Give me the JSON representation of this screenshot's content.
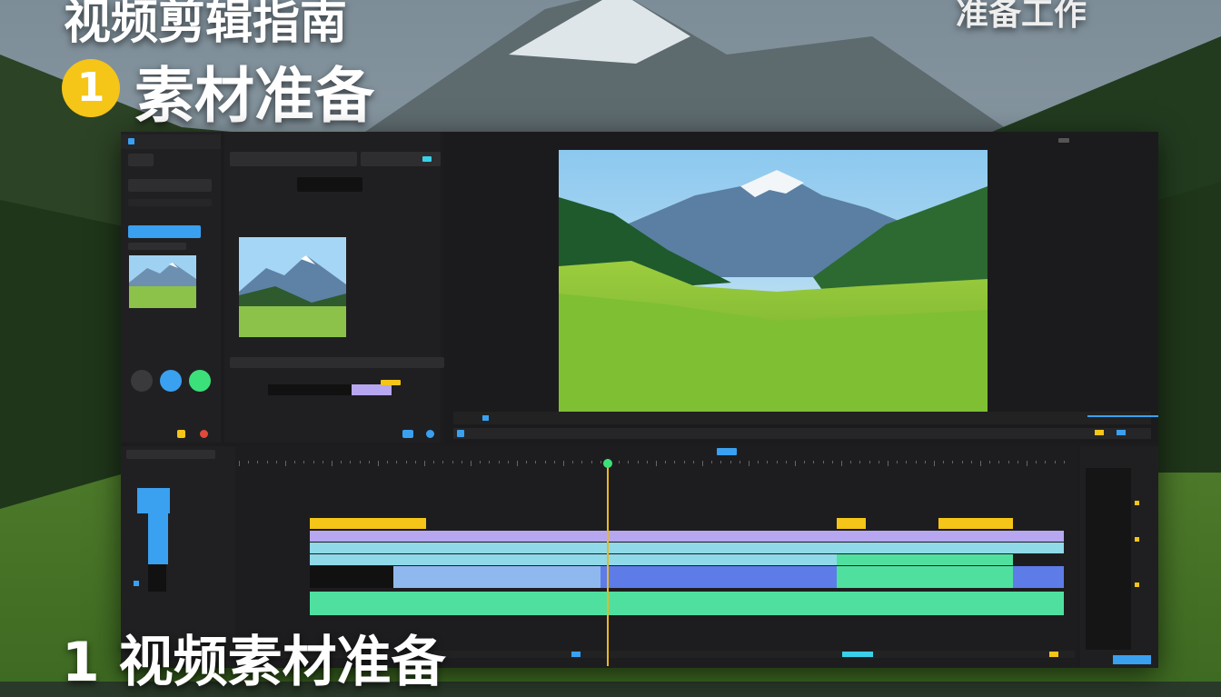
{
  "overlay": {
    "top_left_title": "视频剪辑指南",
    "top_right_title": "准备工作",
    "step_number": "1",
    "step_title": "素材准备",
    "bottom_caption": "1 视频素材准备"
  },
  "colors": {
    "accent_blue": "#3aa0f0",
    "accent_green": "#3ce07a",
    "accent_yellow": "#f5c518",
    "clip_purple": "#b7a6f0",
    "clip_cyan": "#8fd9e8",
    "clip_green": "#4fe0a0",
    "clip_blue": "#5d7ce8",
    "playhead": "#e8b923"
  },
  "icons": [
    "media-icon",
    "close-icon",
    "settings-icon",
    "play-icon",
    "record-icon",
    "audio-icon",
    "lock-icon",
    "eye-icon"
  ]
}
